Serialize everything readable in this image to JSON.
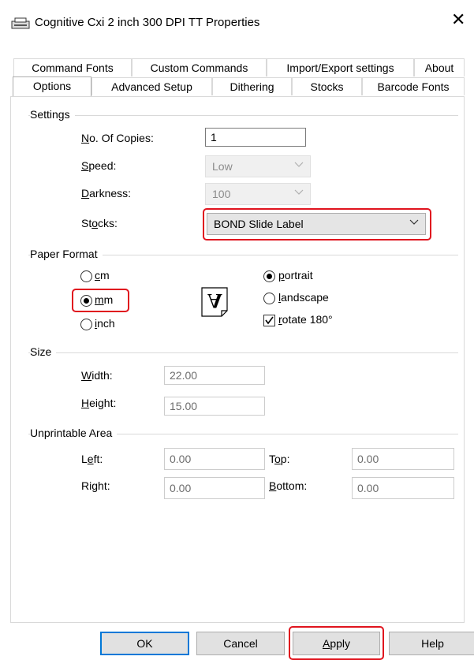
{
  "window": {
    "title": "Cognitive Cxi 2 inch 300 DPI TT Properties",
    "close_glyph": "✕"
  },
  "tabs_row1": [
    "Command Fonts",
    "Custom Commands",
    "Import/Export settings",
    "About"
  ],
  "tabs_row2": [
    "Options",
    "Advanced Setup",
    "Dithering",
    "Stocks",
    "Barcode Fonts"
  ],
  "settings": {
    "group": "Settings",
    "copies_label_u": "N",
    "copies_label_rest": "o. Of Copies:",
    "copies_value": "1",
    "speed_label_u": "S",
    "speed_label_rest": "peed:",
    "speed_value": "Low",
    "darkness_label_u": "D",
    "darkness_label_rest": "arkness:",
    "darkness_value": "100",
    "stocks_label_pre": "St",
    "stocks_label_u": "o",
    "stocks_label_rest": "cks:",
    "stocks_value": "BOND Slide Label"
  },
  "paper": {
    "group": "Paper Format",
    "cm_u": "c",
    "cm_rest": "m",
    "mm_u": "m",
    "mm_rest": "m",
    "inch_u": "i",
    "inch_rest": "nch",
    "portrait_u": "p",
    "portrait_rest": "ortrait",
    "landscape_u": "l",
    "landscape_rest": "andscape",
    "rotate_u": "r",
    "rotate_rest": "otate 180°",
    "unit_selected": "mm",
    "orientation_selected": "portrait",
    "rotate_checked": true,
    "preview_glyph": "A"
  },
  "size": {
    "group": "Size",
    "width_label_u": "W",
    "width_label_rest": "idth:",
    "width_value": "22.00",
    "height_label_u": "H",
    "height_label_rest": "eight:",
    "height_value": "15.00"
  },
  "unprintable": {
    "group": "Unprintable Area",
    "left_label_pre": "L",
    "left_label_u": "e",
    "left_label_rest": "ft:",
    "left_value": "0.00",
    "top_label_pre": "T",
    "top_label_u": "o",
    "top_label_rest": "p:",
    "top_value": "0.00",
    "right_label_pre": "Ri",
    "right_label_u": "g",
    "right_label_rest": "ht:",
    "right_value": "0.00",
    "bottom_label_u": "B",
    "bottom_label_rest": "ottom:",
    "bottom_value": "0.00"
  },
  "buttons": {
    "ok": "OK",
    "cancel": "Cancel",
    "apply_u": "A",
    "apply_rest": "pply",
    "help": "Help"
  },
  "colors": {
    "highlight": "#e0141e",
    "focus": "#0078d7"
  }
}
